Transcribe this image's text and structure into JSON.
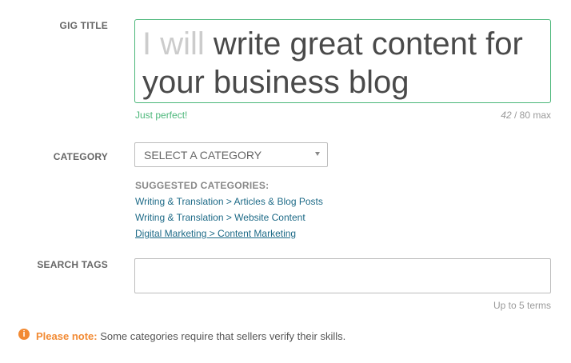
{
  "gig_title": {
    "label": "GIG TITLE",
    "prefix": "I will",
    "value": "write great content for your business blog",
    "status": "Just perfect!",
    "count_current": "42",
    "count_max": " / 80 max"
  },
  "category": {
    "label": "CATEGORY",
    "select_value": "SELECT A CATEGORY",
    "suggested_heading": "SUGGESTED CATEGORIES:",
    "suggestions": [
      "Writing & Translation > Articles & Blog Posts",
      "Writing & Translation > Website Content",
      "Digital Marketing > Content Marketing"
    ]
  },
  "search_tags": {
    "label": "SEARCH TAGS",
    "value": "",
    "hint": "Up to 5 terms"
  },
  "note": {
    "icon": "info-icon",
    "strong": "Please note:",
    "text": " Some categories require that sellers verify their skills."
  },
  "colors": {
    "accent_green": "#4cb77a",
    "warning_orange": "#f28a33",
    "link_blue": "#1d6a87"
  }
}
